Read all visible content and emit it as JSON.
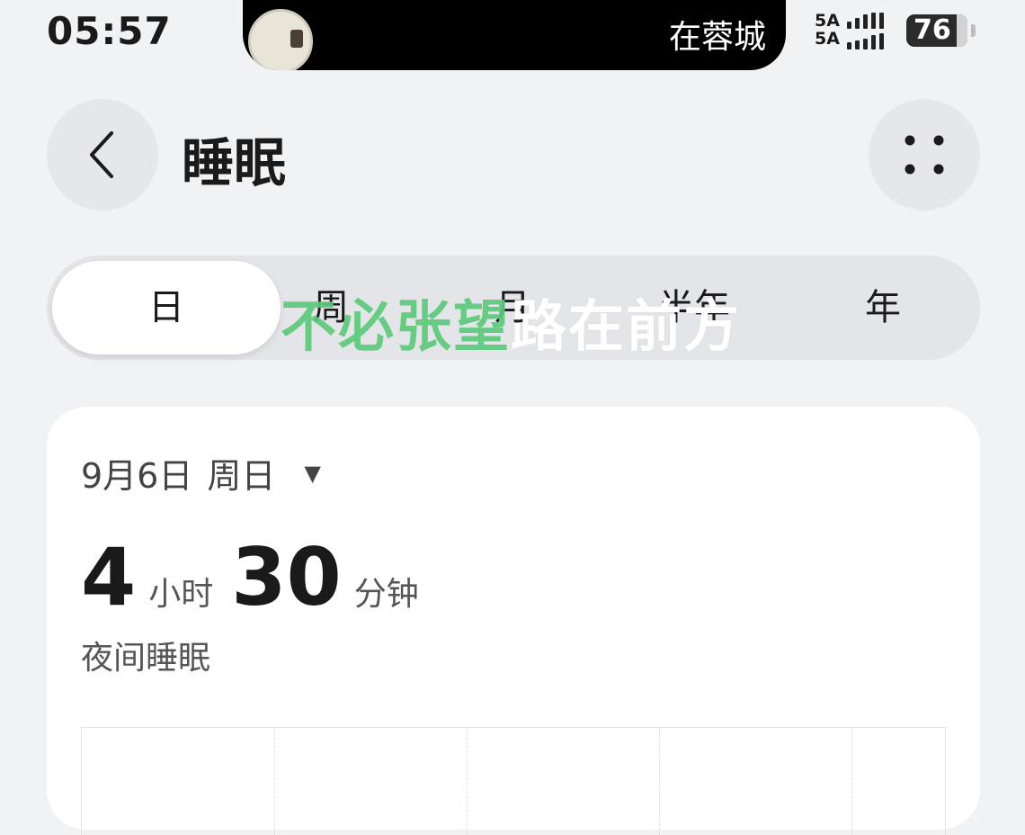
{
  "status_bar": {
    "time": "05:57",
    "island_text": "在蓉城",
    "signal_top": "5A",
    "signal_bottom": "5A",
    "battery": "76"
  },
  "header": {
    "title": "睡眠",
    "back_icon": "chevron-left-icon",
    "more_icon": "four-dots-icon"
  },
  "tabs": [
    {
      "label": "日",
      "active": true
    },
    {
      "label": "周",
      "active": false
    },
    {
      "label": "月",
      "active": false
    },
    {
      "label": "半年",
      "active": false
    },
    {
      "label": "年",
      "active": false
    }
  ],
  "watermark": {
    "part1": "不必张望",
    "part2": "路在前方"
  },
  "card": {
    "date": "9月6日",
    "weekday": "周日",
    "dropdown_icon": "caret-down-icon",
    "hours": "4",
    "hours_unit": "小时",
    "minutes": "30",
    "minutes_unit": "分钟",
    "sleep_type": "夜间睡眠"
  }
}
